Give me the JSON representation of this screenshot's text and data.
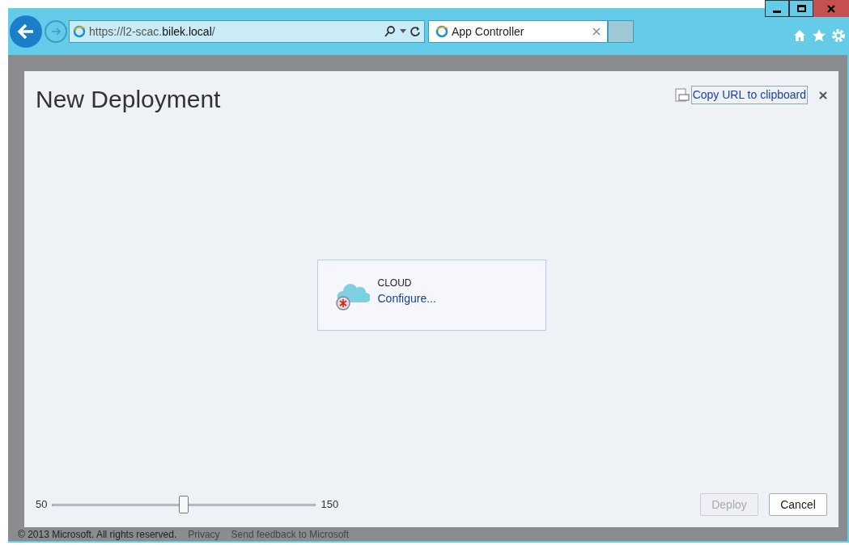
{
  "address_bar": {
    "url_prefix": "https://l2-scac.",
    "url_host": "bilek.local",
    "url_suffix": "/"
  },
  "tabs": [
    {
      "label": "App Controller",
      "selected": true
    }
  ],
  "dialog": {
    "title": "New Deployment",
    "copy_link": "Copy URL to clipboard",
    "tile": {
      "heading": "CLOUD",
      "link": "Configure..."
    },
    "slider": {
      "min_label": "50",
      "max_label": "150",
      "level": 0.5
    },
    "buttons": [
      {
        "label": "Deploy",
        "disabled": true
      },
      {
        "label": "Cancel",
        "disabled": false
      }
    ]
  },
  "footer": {
    "copyright": "© 2013 Microsoft. All rights reserved.",
    "links": [
      "Privacy",
      "Send feedback to Microsoft"
    ]
  }
}
